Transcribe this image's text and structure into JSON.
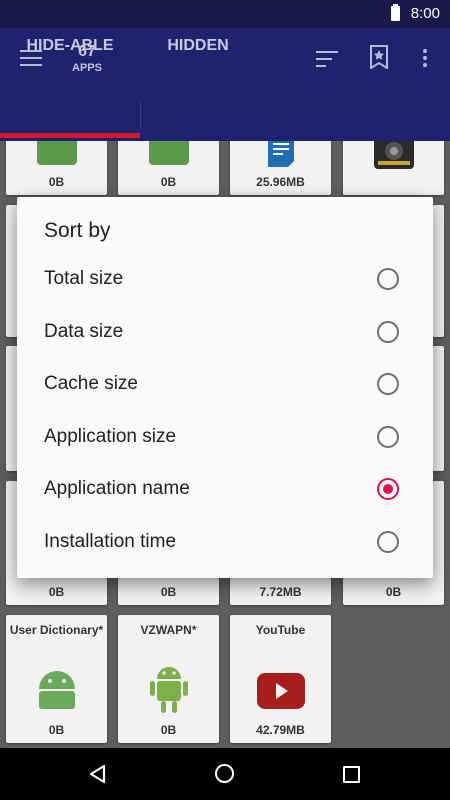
{
  "status_bar": {
    "time": "8:00",
    "battery_icon": "battery-full-icon"
  },
  "app_bar": {
    "menu_icon": "hamburger-menu-icon",
    "app_count": "67",
    "app_count_label": "APPS",
    "sort_icon": "sort-icon",
    "bookmark_icon": "bookmark-star-icon",
    "more_icon": "more-vert-icon"
  },
  "tabs": [
    {
      "label": "HIDE-ABLE",
      "selected": true
    },
    {
      "label": "HIDDEN",
      "selected": false
    }
  ],
  "grid": {
    "row1": [
      {
        "size": "0B",
        "icon": "android-icon"
      },
      {
        "size": "0B",
        "icon": "android-icon"
      },
      {
        "size": "25.96MB",
        "icon": "document-icon"
      },
      {
        "size": "",
        "icon": "device-icon"
      }
    ],
    "row_mid": [
      {
        "size": "0B"
      },
      {
        "size": "0B"
      },
      {
        "size": "7.72MB"
      },
      {
        "size": "0B"
      }
    ],
    "row_last": [
      {
        "name": "User Dictionary*",
        "size": "0B",
        "icon": "android-icon"
      },
      {
        "name": "VZWAPN*",
        "size": "0B",
        "icon": "android-robot-icon"
      },
      {
        "name": "YouTube",
        "size": "42.79MB",
        "icon": "youtube-icon"
      }
    ]
  },
  "dialog": {
    "title": "Sort by",
    "options": [
      {
        "label": "Total size",
        "selected": false
      },
      {
        "label": "Data size",
        "selected": false
      },
      {
        "label": "Cache size",
        "selected": false
      },
      {
        "label": "Application size",
        "selected": false
      },
      {
        "label": "Application name",
        "selected": true
      },
      {
        "label": "Installation time",
        "selected": false
      }
    ],
    "accent_color": "#e8124a"
  },
  "nav_bar": {
    "back_icon": "back-icon",
    "home_icon": "home-icon",
    "recents_icon": "recents-icon"
  }
}
